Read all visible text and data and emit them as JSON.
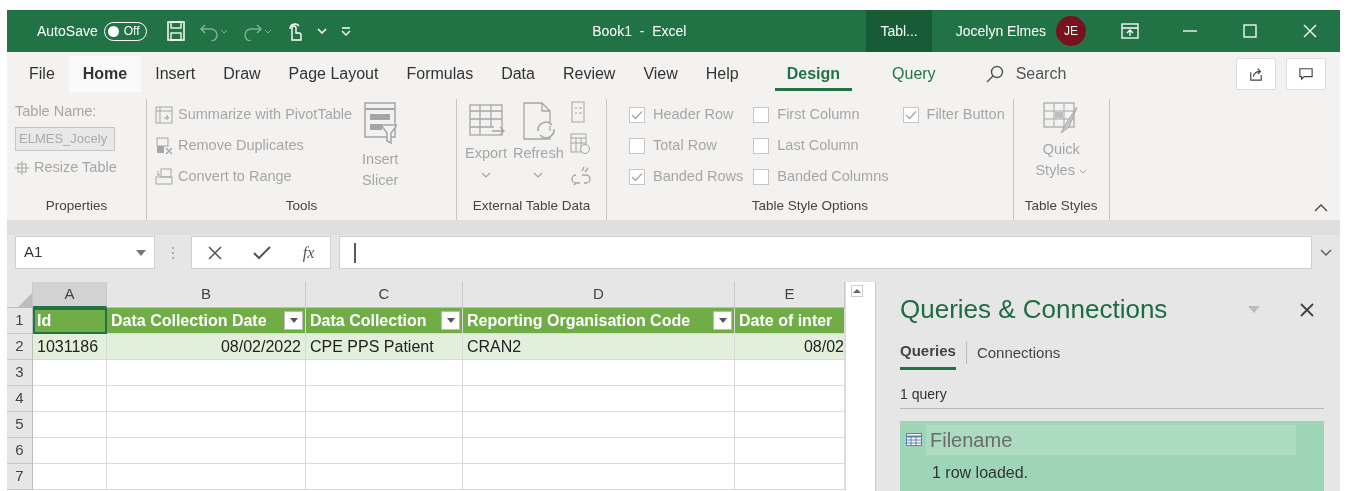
{
  "title_bar": {
    "autosave_label": "AutoSave",
    "autosave_toggle": {
      "text": "Off",
      "on": false
    },
    "title": "Book1  -  Excel",
    "context_tab": "Tabl...",
    "user_name": "Jocelyn Elmes",
    "avatar_initials": "JE"
  },
  "ribbon_tabs": [
    {
      "label": "File",
      "selected": false,
      "highlighted": false,
      "contextual": false
    },
    {
      "label": "Home",
      "selected": false,
      "highlighted": true,
      "contextual": false
    },
    {
      "label": "Insert",
      "selected": false,
      "highlighted": false,
      "contextual": false
    },
    {
      "label": "Draw",
      "selected": false,
      "highlighted": false,
      "contextual": false
    },
    {
      "label": "Page Layout",
      "selected": false,
      "highlighted": false,
      "contextual": false
    },
    {
      "label": "Formulas",
      "selected": false,
      "highlighted": false,
      "contextual": false
    },
    {
      "label": "Data",
      "selected": false,
      "highlighted": false,
      "contextual": false
    },
    {
      "label": "Review",
      "selected": false,
      "highlighted": false,
      "contextual": false
    },
    {
      "label": "View",
      "selected": false,
      "highlighted": false,
      "contextual": false
    },
    {
      "label": "Help",
      "selected": false,
      "highlighted": false,
      "contextual": false
    },
    {
      "label": "Design",
      "selected": true,
      "highlighted": false,
      "contextual": true
    },
    {
      "label": "Query",
      "selected": false,
      "highlighted": false,
      "contextual": true
    }
  ],
  "search": {
    "placeholder": "Search"
  },
  "ribbon": {
    "properties": {
      "label": "Properties",
      "table_name_label": "Table Name:",
      "table_name_value": "ELMES_Jocely",
      "resize": "Resize Table"
    },
    "tools": {
      "label": "Tools",
      "items": [
        "Summarize with PivotTable",
        "Remove Duplicates",
        "Convert to Range"
      ],
      "slicer": [
        "Insert",
        "Slicer"
      ]
    },
    "external": {
      "label": "External Table Data",
      "export": "Export",
      "refresh": "Refresh"
    },
    "style_options": {
      "label": "Table Style Options",
      "checkboxes": [
        {
          "label": "Header Row",
          "checked": true
        },
        {
          "label": "Total Row",
          "checked": false
        },
        {
          "label": "Banded Rows",
          "checked": true
        },
        {
          "label": "First Column",
          "checked": false
        },
        {
          "label": "Last Column",
          "checked": false
        },
        {
          "label": "Banded Columns",
          "checked": false
        },
        {
          "label": "Filter Button",
          "checked": true
        }
      ]
    },
    "table_styles": {
      "label": "Table Styles",
      "quick": [
        "Quick",
        "Styles"
      ]
    }
  },
  "formula_bar": {
    "name_box": "A1",
    "fx": "fx"
  },
  "sheet": {
    "columns": [
      {
        "letter": "A",
        "selected": true
      },
      {
        "letter": "B",
        "selected": false
      },
      {
        "letter": "C",
        "selected": false
      },
      {
        "letter": "D",
        "selected": false
      },
      {
        "letter": "E",
        "selected": false
      }
    ],
    "row_numbers": [
      "1",
      "2",
      "3",
      "4",
      "5",
      "6",
      "7"
    ],
    "header_row": [
      "Id",
      "Data Collection Date",
      "Data Collection",
      "Reporting Organisation Code",
      "Date of inter"
    ],
    "data_row": [
      "1031186",
      "08/02/2022",
      "CPE PPS Patient",
      "CRAN2",
      "08/02"
    ]
  },
  "queries_panel": {
    "title": "Queries & Connections",
    "tabs": [
      {
        "label": "Queries",
        "selected": true
      },
      {
        "label": "Connections",
        "selected": false
      }
    ],
    "count": "1 query",
    "queries": [
      {
        "name": "Filename",
        "status": "1 row loaded."
      }
    ]
  }
}
